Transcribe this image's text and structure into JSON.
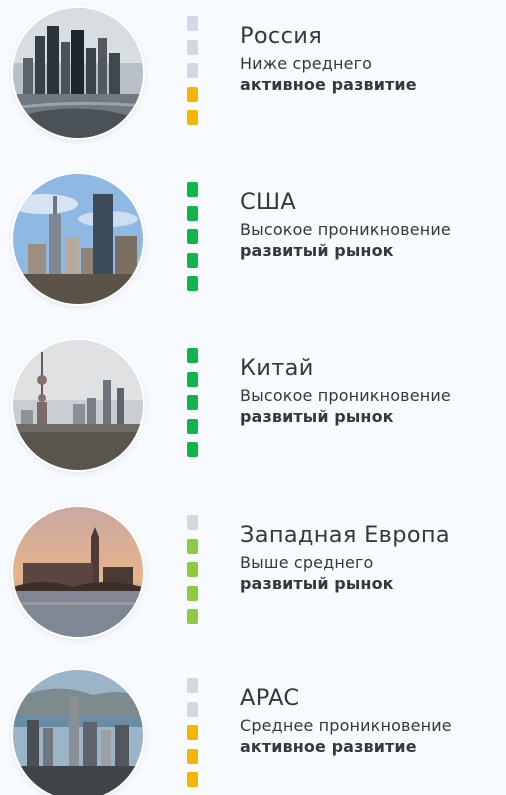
{
  "colors": {
    "inactive": "#d3d8e2",
    "developed": "#12b34a",
    "above_average": "#8ccb3f",
    "active": "#f5b400"
  },
  "regions": [
    {
      "name": "Россия",
      "level": "Ниже среднего",
      "stage": "активное развитие",
      "bars": [
        "inactive",
        "inactive",
        "inactive",
        "active",
        "active"
      ],
      "photo_icon": "city-skyline-photo"
    },
    {
      "name": "США",
      "level": "Высокое проникновение",
      "stage": "развитый рынок",
      "bars": [
        "developed",
        "developed",
        "developed",
        "developed",
        "developed"
      ],
      "photo_icon": "city-skyline-photo"
    },
    {
      "name": "Китай",
      "level": "Высокое проникновение",
      "stage": "развитый рынок",
      "bars": [
        "developed",
        "developed",
        "developed",
        "developed",
        "developed"
      ],
      "photo_icon": "city-skyline-photo"
    },
    {
      "name": "Западная Европа",
      "level": "Выше среднего",
      "stage": "развитый рынок",
      "bars": [
        "inactive",
        "above_average",
        "above_average",
        "above_average",
        "above_average"
      ],
      "photo_icon": "city-skyline-photo"
    },
    {
      "name": "APAC",
      "level": "Среднее проникновение",
      "stage": "активное развитие",
      "bars": [
        "inactive",
        "inactive",
        "active",
        "active",
        "active"
      ],
      "photo_icon": "city-skyline-photo"
    }
  ]
}
